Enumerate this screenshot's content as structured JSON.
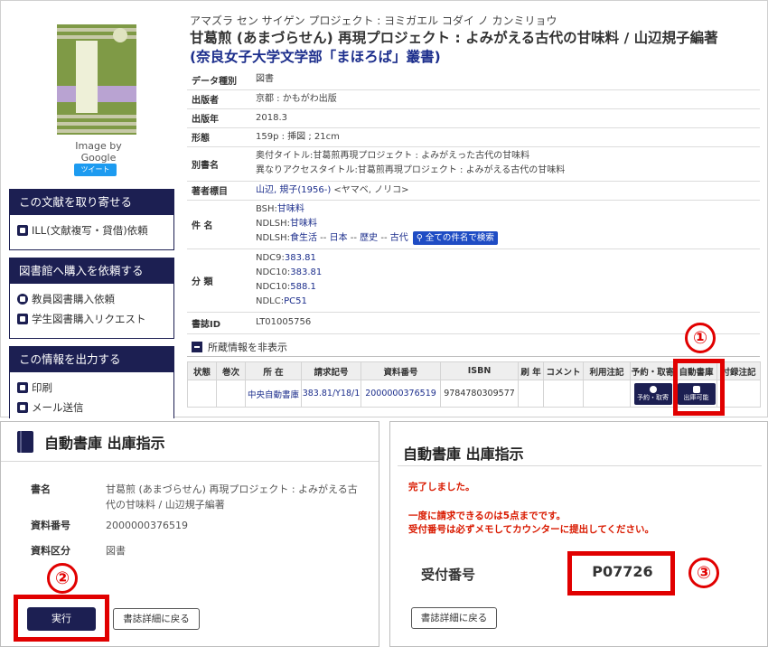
{
  "sidebar": {
    "image_credit": "Image by Google",
    "tweet_label": "ツイート",
    "order_box": {
      "title": "この文献を取り寄せる",
      "items": [
        "ILL(文献複写・貸借)依頼"
      ]
    },
    "purchase_box": {
      "title": "図書館へ購入を依頼する",
      "items": [
        "教員図書購入依頼",
        "学生図書購入リクエスト"
      ]
    },
    "export_box": {
      "title": "この情報を出力する",
      "items": [
        "印刷",
        "メール送信"
      ]
    }
  },
  "record": {
    "kana": "アマズラ セン サイゲン プロジェクト : ヨミガエル コダイ ノ カンミリョウ",
    "title_main": "甘葛煎 (あまづらせん) 再現プロジェクト : よみがえる古代の甘味料 / 山辺規子編著",
    "title_series": "(奈良女子大学文学部「まほろば」叢書)",
    "fields": {
      "type_label": "データ種別",
      "type_value": "図書",
      "publisher_label": "出版者",
      "publisher_value": "京都 : かもがわ出版",
      "year_label": "出版年",
      "year_value": "2018.3",
      "form_label": "形態",
      "form_value": "159p : 挿図 ; 21cm",
      "alt_label": "別書名",
      "alt_value1": "奥付タイトル:甘葛煎再現プロジェクト : よみがえった古代の甘味料",
      "alt_value2": "異なりアクセスタイトル:甘葛煎再現プロジェクト : よみがえる古代の甘味料",
      "author_label": "著者標目",
      "author_link": "山辺, 規子(1956-)",
      "author_kana": "<ヤマベ, ノリコ>",
      "subject_label": "件 名",
      "subj1_prefix": "BSH:",
      "subj1_link": "甘味料",
      "subj2_prefix": "NDLSH:",
      "subj2_link": "甘味料",
      "subj3_prefix": "NDLSH:",
      "subj3_a": "食生活",
      "subj3_b": "日本",
      "subj3_c": "歴史",
      "subj3_d": "古代",
      "sep": " -- ",
      "search_all": "全ての件名で検索",
      "class_label": "分 類",
      "cls1_prefix": "NDC9:",
      "cls1_link": "383.81",
      "cls2_prefix": "NDC10:",
      "cls2_link": "383.81",
      "cls3_prefix": "NDC10:",
      "cls3_link": "588.1",
      "cls4_prefix": "NDLC:",
      "cls4_link": "PC51",
      "id_label": "書誌ID",
      "id_value": "LT01005756"
    }
  },
  "holdings": {
    "toggle_label": "所蔵情報を非表示",
    "headers": [
      "状態",
      "巻次",
      "所 在",
      "請求記号",
      "資料番号",
      "ISBN",
      "刷 年",
      "コメント",
      "利用注記",
      "予約・取寄",
      "自動書庫",
      "付録注記"
    ],
    "row": {
      "location": "中央自動書庫",
      "call_number": "383.81/Y18/1",
      "item_number": "2000000376519",
      "isbn": "9784780309577",
      "reserve_btn": "予約・取寄",
      "retrieve_btn": "出庫可能"
    }
  },
  "annotations": {
    "n1": "①",
    "n2": "②",
    "n3": "③"
  },
  "dispatch_panel": {
    "title": "自動書庫 出庫指示",
    "book_label": "書名",
    "book_value": "甘葛煎 (あまづらせん) 再現プロジェクト : よみがえる古代の甘味料 / 山辺規子編著",
    "item_label": "資料番号",
    "item_value": "2000000376519",
    "category_label": "資料区分",
    "category_value": "図書",
    "execute_label": "実行",
    "back_label": "書誌詳細に戻る"
  },
  "done_panel": {
    "title": "自動書庫 出庫指示",
    "msg_done": "完了しました。",
    "msg_limit": "一度に請求できるのは5点までです。",
    "msg_memo": "受付番号は必ずメモしてカウンターに提出してください。",
    "receipt_label": "受付番号",
    "receipt_number": "P07726",
    "back_label": "書誌詳細に戻る"
  },
  "colors": {
    "navy": "#1c1f52",
    "link": "#1c2e8c",
    "red": "#e10000",
    "search": "#1f4cc4"
  }
}
